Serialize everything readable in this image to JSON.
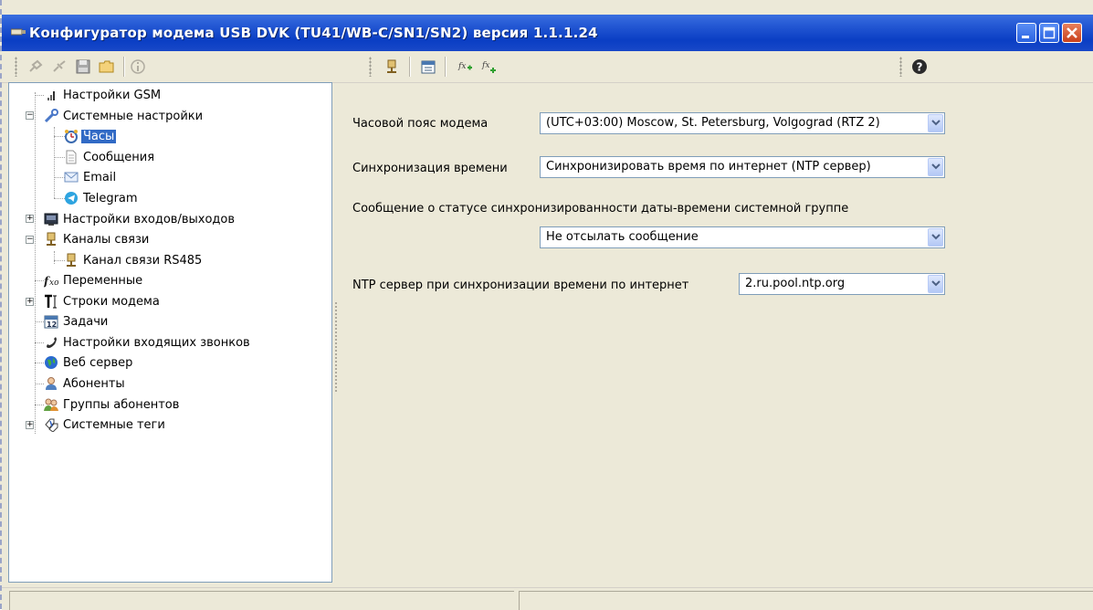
{
  "window": {
    "title": "Конфигуратор модема USB DVK (TU41/WB-C/SN1/SN2)  версия 1.1.1.24"
  },
  "tree": {
    "items": [
      {
        "label": "Настройки GSM",
        "icon": "signal-bars-icon"
      },
      {
        "label": "Системные настройки",
        "icon": "wrench-icon",
        "expanded": true
      },
      {
        "label": "Часы",
        "icon": "clock-icon",
        "selected": true
      },
      {
        "label": "Сообщения",
        "icon": "document-icon"
      },
      {
        "label": "Email",
        "icon": "envelope-icon"
      },
      {
        "label": "Telegram",
        "icon": "telegram-icon"
      },
      {
        "label": "Настройки входов/выходов",
        "icon": "io-board-icon",
        "expandable": true
      },
      {
        "label": "Каналы связи",
        "icon": "connector-icon",
        "expanded": true
      },
      {
        "label": "Канал связи RS485",
        "icon": "connector-icon"
      },
      {
        "label": "Переменные",
        "icon": "fx-icon"
      },
      {
        "label": "Строки модема",
        "icon": "text-cursor-icon",
        "expandable": true
      },
      {
        "label": "Задачи",
        "icon": "calendar-icon"
      },
      {
        "label": "Настройки входящих звонков",
        "icon": "phone-icon"
      },
      {
        "label": "Веб сервер",
        "icon": "globe-icon"
      },
      {
        "label": "Абоненты",
        "icon": "person-icon"
      },
      {
        "label": "Группы абонентов",
        "icon": "group-icon"
      },
      {
        "label": "Системные теги",
        "icon": "tags-icon",
        "expandable": true
      }
    ]
  },
  "form": {
    "timezone_label": "Часовой пояс модема",
    "timezone_value": "(UTC+03:00) Moscow, St. Petersburg, Volgograd (RTZ 2)",
    "sync_label": "Синхронизация времени",
    "sync_value": "Синхронизировать время по интернет (NTP сервер)",
    "status_msg_label": "Сообщение о статусе синхронизированности даты-времени системной группе",
    "status_msg_value": "Не отсылать сообщение",
    "ntp_label": "NTP сервер при синхронизации времени по интернет",
    "ntp_value": "2.ru.pool.ntp.org"
  },
  "colors": {
    "titlebar": "#0a3ec4",
    "selection": "#316ac5",
    "window_bg": "#ece9d8"
  }
}
